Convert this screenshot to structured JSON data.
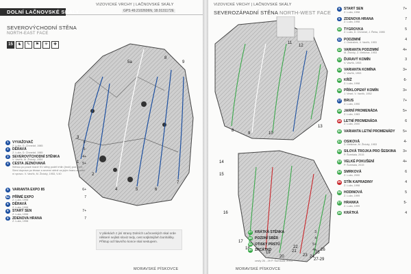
{
  "colors": {
    "green": "#3aa84a",
    "blue": "#1c4fa0",
    "red": "#c9262b",
    "text": "#222222",
    "muted": "#777777",
    "band": "#2d2d2d"
  },
  "left": {
    "running_header": "VIZOVICKÉ VRCHY | LAČNOVSKÉ SKÁLY",
    "title": "DOLNÍ LAČNOVSKÉ SKÁLY",
    "gps": "GPS 49.2102606N, 18.0131172E",
    "sector_cz": "SEVEROVÝCHODNÍ STĚNA",
    "sector_en": "NORTH-EAST FACE",
    "icons": [
      {
        "name": "routes-count-icon",
        "text": "15"
      },
      {
        "name": "person-icon",
        "text": "♞"
      },
      {
        "name": "hammer-icon",
        "text": "✎"
      },
      {
        "name": "family-icon",
        "text": "⚑"
      },
      {
        "name": "sun-icon",
        "text": "✳"
      },
      {
        "name": "compass-icon",
        "text": "✚"
      }
    ],
    "topo_numbers": [
      "1",
      "2",
      "3",
      "4",
      "5",
      "5a",
      "6",
      "7",
      "8",
      "9"
    ],
    "routes": [
      {
        "num": "1",
        "color": "blue",
        "name": "VYVAŽOVAČ",
        "grade": "6-",
        "author": "Z. Luža, D. Chmelař, 1985"
      },
      {
        "num": "2",
        "color": "blue",
        "name": "DĚRAVÁ",
        "grade": "5-",
        "author": "Z. Luža, D. Chmelař, 1985"
      },
      {
        "num": "3",
        "color": "blue",
        "name": "SEVEROVÝCHODNÍ STĚNKA",
        "grade": "4+",
        "author": "V. Vavřík, M. Živický, 1954"
      },
      {
        "num": "4",
        "color": "blue",
        "name": "CESTA JEZNOVANÁ",
        "grade": "5+",
        "author": "",
        "desc": "Stěnou po pravé hraně SV stěny podél trhlin (hrutí) pod plíně. Stení doprava po těrase a severní stěně za jejím hranu a podél ní vpravo. V. Vavřík, M. Živický, 1953, V.40"
      },
      {
        "num": "5",
        "color": "blue",
        "name": "VARIANTA EXPO 85",
        "grade": "6+",
        "author": ""
      },
      {
        "num": "5a",
        "color": "blue",
        "name": "PŘÍMÉ EXPO",
        "grade": "7",
        "author": "Z. Luža, 1998"
      },
      {
        "num": "6",
        "color": "blue",
        "name": "DĚRAVÁ",
        "grade": "",
        "author": "Z. Luža, 1998"
      },
      {
        "num": "8",
        "color": "blue",
        "name": "STARÝ SEN",
        "grade": "7+",
        "author": "Z. Luža, 1998"
      },
      {
        "num": "9",
        "color": "blue",
        "name": "ZDENOVA HRANA",
        "grade": "7",
        "author": "Z. Luža, 1998"
      }
    ],
    "note": "V plánkách z jiní strany Dolních Lačnovských skal orde některé nejlisti sloviz tedy, cest sotjkitnijšeh bonhášky. Přístup od hlavního konce skal sestupem.",
    "footer": "MORAVSKÉ PÍSKOVCE"
  },
  "right": {
    "running_header": "VIZOVICKÉ VRCHY | LAČNOVSKÉ SKÁLY",
    "sector_cz": "SEVEROZÁPADNÍ STĚNA",
    "sector_en": "NORTH-WEST FACE",
    "topo_numbers": [
      "8",
      "9",
      "10",
      "11",
      "12",
      "13",
      "14",
      "15",
      "16",
      "17",
      "18",
      "19",
      "20",
      "21",
      "22",
      "23",
      "24",
      "25",
      "26",
      "27-29"
    ],
    "routes": [
      {
        "num": "8",
        "color": "blue",
        "name": "STARÝ SEN",
        "grade": "7+",
        "author": "Z. Luža, 1998"
      },
      {
        "num": "9",
        "color": "blue",
        "name": "ZDENOVA HRANA",
        "grade": "7",
        "author": "Z. Luža, 1998"
      },
      {
        "num": "10",
        "color": "green",
        "name": "TYGROVKA",
        "grade": "5",
        "author": "Z. Luža, D. Chmelař, J. Řeha, 1985"
      },
      {
        "num": "11",
        "color": "blue",
        "name": "PODZIMNÍ",
        "grade": "4",
        "author": "J. Ondráček, V. Vavřík, 1953"
      },
      {
        "num": "12",
        "color": "green",
        "name": "VARIANTA PODZIMNÍ",
        "grade": "4+",
        "author": "M. Živický, Z. Melichar, 1953"
      },
      {
        "num": "13",
        "color": "green",
        "name": "ĎURAVÝ KOMÍN",
        "grade": "3",
        "author": "V. Vavřík, 1953"
      },
      {
        "num": "14",
        "color": "green",
        "name": "VARIANTA KOMÍNA",
        "grade": "3+",
        "author": "V. Vavřík, 1953"
      },
      {
        "num": "15",
        "color": "green",
        "name": "KŘÍŽ",
        "grade": "6-",
        "author": "Z. Luža, 1998"
      },
      {
        "num": "16",
        "color": "green",
        "name": "PŘÍKLOPENÝ KOMÍN",
        "grade": "3+",
        "author": "J. Vesel, V. Vavřík, 1952"
      },
      {
        "num": "17",
        "color": "blue",
        "name": "BRUS",
        "grade": "7+",
        "author": "Z. Luža, 1990"
      },
      {
        "num": "18",
        "color": "green",
        "name": "JARNÍ PROMENÁDA",
        "grade": "5+",
        "author": "Z. Luža, 1983"
      },
      {
        "num": "19",
        "color": "red",
        "name": "LETNÍ PROMENÁDA",
        "grade": "6",
        "author": "Z. Luža, 2000"
      },
      {
        "num": "20",
        "color": "green",
        "name": "VARIANTA LETNÍ PROMENÁDY",
        "grade": "5+",
        "author": ""
      },
      {
        "num": "21",
        "color": "green",
        "name": "OSIKOVÁ",
        "grade": "4-",
        "author": "Z. Melichar, M. Živický, 1953"
      },
      {
        "num": "22",
        "color": "green",
        "name": "SILOVÁ TROJKA PRO ŠESKINA",
        "grade": "3+",
        "author": "P. Šumšala, 2015"
      },
      {
        "num": "23",
        "color": "green",
        "name": "VELKÉ POKUŠENÍ",
        "grade": "4+",
        "author": "P. Šumšala, 2015"
      },
      {
        "num": "24",
        "color": "green",
        "name": "SMRKOVÁ",
        "grade": "6",
        "author": "Z. Luža, 2000"
      },
      {
        "num": "25",
        "color": "red",
        "name": "STÍN KAPRADINY",
        "grade": "4",
        "author": "Z. Luža, 1998"
      },
      {
        "num": "26",
        "color": "green",
        "name": "HODINOVÁ",
        "grade": "5",
        "author": "Z. Luža, 1999"
      },
      {
        "num": "27",
        "color": "green",
        "name": "HRANKA",
        "grade": "5-",
        "author": "Z. Luža, 1999"
      },
      {
        "num": "28",
        "color": "green",
        "name": "KRÁTKÁ",
        "grade": "4",
        "author": ""
      }
    ],
    "bottom_routes": [
      {
        "num": "27",
        "color": "green",
        "name": "KRÁTKÁ STĚNKA",
        "grade": "3"
      },
      {
        "num": "28",
        "color": "green",
        "name": "POZDNÍ SBĚR",
        "grade": "4"
      },
      {
        "num": "29",
        "color": "green",
        "name": "OTISKY PRSTŮ",
        "grade": "5+"
      },
      {
        "num": "30",
        "color": "green",
        "name": "ZRCÁTKO",
        "grade": "4+"
      }
    ],
    "bottom_author": "cesty 26 - 29 P. Šumšala, 2015",
    "footer": "MORAVSKÉ PÍSKOVCE"
  }
}
